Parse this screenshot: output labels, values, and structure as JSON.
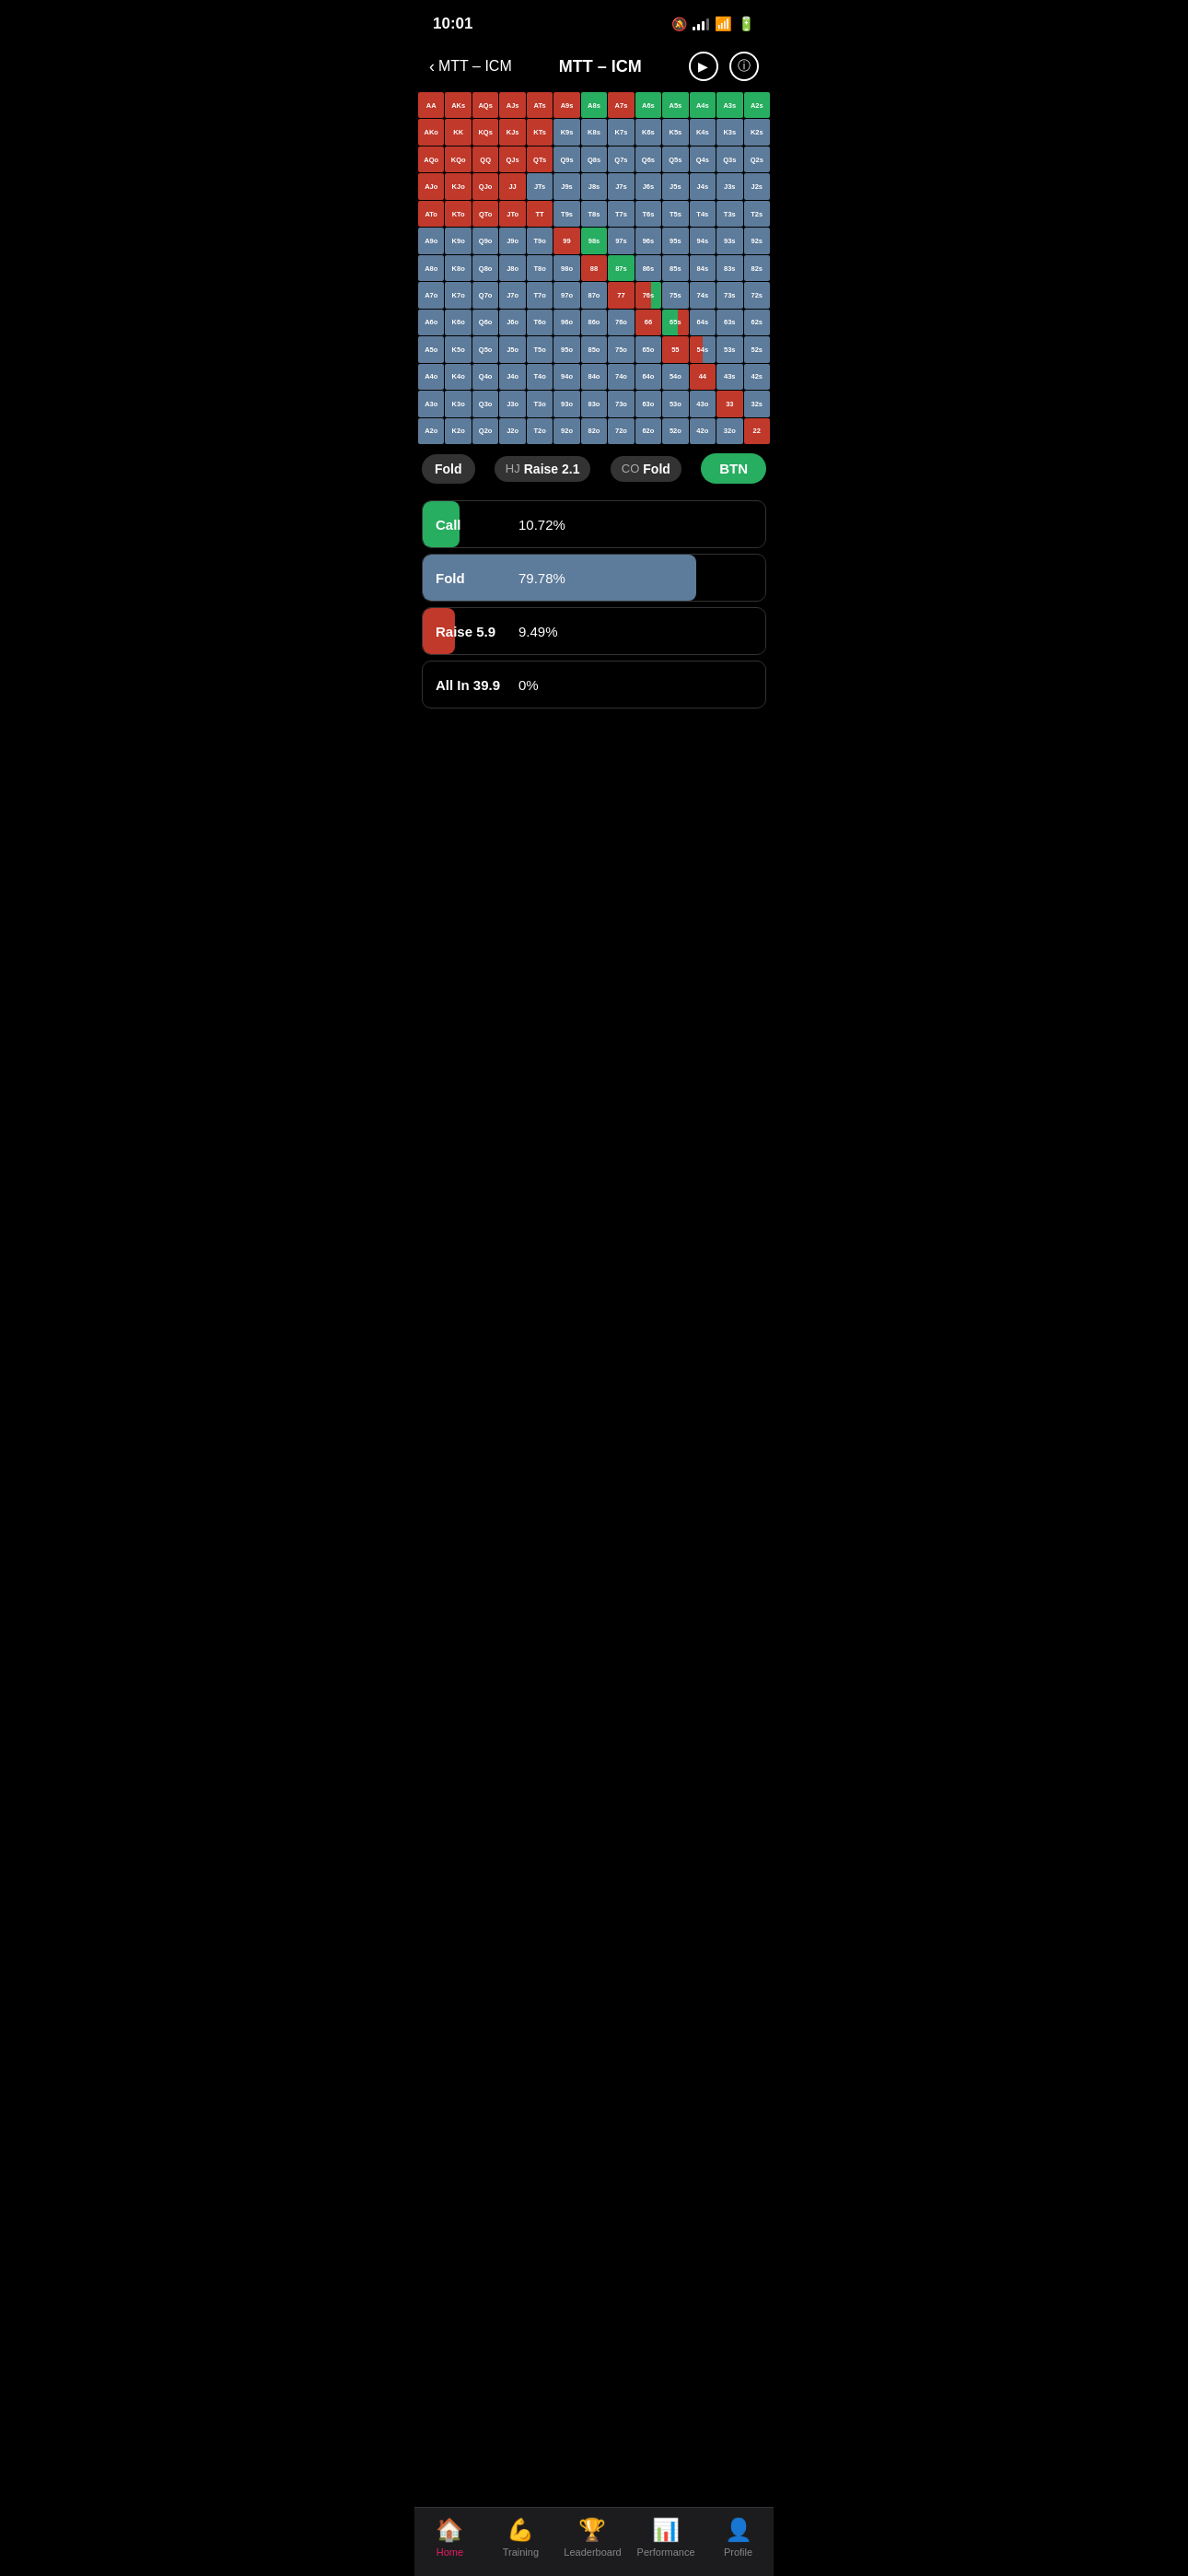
{
  "statusBar": {
    "time": "10:01",
    "bell": "🔕"
  },
  "header": {
    "backLabel": "MTT – ICM",
    "title": "MTT – ICM"
  },
  "grid": {
    "rows": [
      [
        "AA",
        "AKs",
        "AQs",
        "AJs",
        "ATs",
        "A9s",
        "A8s",
        "A7s",
        "A6s",
        "A5s",
        "A4s",
        "A3s",
        "A2s"
      ],
      [
        "AKo",
        "KK",
        "KQs",
        "KJs",
        "KTs",
        "K9s",
        "K8s",
        "K7s",
        "K6s",
        "K5s",
        "K4s",
        "K3s",
        "K2s"
      ],
      [
        "AQo",
        "KQo",
        "QQ",
        "QJs",
        "QTs",
        "Q9s",
        "Q8s",
        "Q7s",
        "Q6s",
        "Q5s",
        "Q4s",
        "Q3s",
        "Q2s"
      ],
      [
        "AJo",
        "KJo",
        "QJo",
        "JJ",
        "JTs",
        "J9s",
        "J8s",
        "J7s",
        "J6s",
        "J5s",
        "J4s",
        "J3s",
        "J2s"
      ],
      [
        "ATo",
        "KTo",
        "QTo",
        "JTo",
        "TT",
        "T9s",
        "T8s",
        "T7s",
        "T6s",
        "T5s",
        "T4s",
        "T3s",
        "T2s"
      ],
      [
        "A9o",
        "K9o",
        "Q9o",
        "J9o",
        "T9o",
        "99",
        "98s",
        "97s",
        "96s",
        "95s",
        "94s",
        "93s",
        "92s"
      ],
      [
        "A8o",
        "K8o",
        "Q8o",
        "J8o",
        "T8o",
        "98o",
        "88",
        "87s",
        "86s",
        "85s",
        "84s",
        "83s",
        "82s"
      ],
      [
        "A7o",
        "K7o",
        "Q7o",
        "J7o",
        "T7o",
        "97o",
        "87o",
        "77",
        "76s",
        "75s",
        "74s",
        "73s",
        "72s"
      ],
      [
        "A6o",
        "K6o",
        "Q6o",
        "J6o",
        "T6o",
        "96o",
        "86o",
        "76o",
        "66",
        "65s",
        "64s",
        "63s",
        "62s"
      ],
      [
        "A5o",
        "K5o",
        "Q5o",
        "J5o",
        "T5o",
        "95o",
        "85o",
        "75o",
        "65o",
        "55",
        "54s",
        "53s",
        "52s"
      ],
      [
        "A4o",
        "K4o",
        "Q4o",
        "J4o",
        "T4o",
        "94o",
        "84o",
        "74o",
        "64o",
        "54o",
        "44",
        "43s",
        "42s"
      ],
      [
        "A3o",
        "K3o",
        "Q3o",
        "J3o",
        "T3o",
        "93o",
        "83o",
        "73o",
        "63o",
        "53o",
        "43o",
        "33",
        "32s"
      ],
      [
        "A2o",
        "K2o",
        "Q2o",
        "J2o",
        "T2o",
        "92o",
        "82o",
        "72o",
        "62o",
        "52o",
        "42o",
        "32o",
        "22"
      ]
    ],
    "colors": [
      [
        "red",
        "red",
        "red",
        "red",
        "red",
        "red",
        "green",
        "red",
        "green",
        "green",
        "green",
        "green",
        "green"
      ],
      [
        "red",
        "red",
        "red",
        "red",
        "red",
        "blue",
        "blue",
        "blue",
        "blue",
        "blue",
        "blue",
        "blue",
        "blue"
      ],
      [
        "red",
        "red",
        "red",
        "red",
        "red",
        "blue",
        "blue",
        "blue",
        "blue",
        "blue",
        "blue",
        "blue",
        "blue"
      ],
      [
        "red",
        "red",
        "red",
        "red",
        "blue",
        "blue",
        "blue",
        "blue",
        "blue",
        "blue",
        "blue",
        "blue",
        "blue"
      ],
      [
        "red",
        "red",
        "red",
        "red",
        "red",
        "blue",
        "blue",
        "blue",
        "blue",
        "blue",
        "blue",
        "blue",
        "blue"
      ],
      [
        "blue",
        "blue",
        "blue",
        "blue",
        "blue",
        "red",
        "green",
        "blue",
        "blue",
        "blue",
        "blue",
        "blue",
        "blue"
      ],
      [
        "blue",
        "blue",
        "blue",
        "blue",
        "blue",
        "blue",
        "red",
        "green",
        "blue",
        "blue",
        "blue",
        "blue",
        "blue"
      ],
      [
        "blue",
        "blue",
        "blue",
        "blue",
        "blue",
        "blue",
        "blue",
        "red",
        "mixed-red-green",
        "blue",
        "blue",
        "blue",
        "blue"
      ],
      [
        "blue",
        "blue",
        "blue",
        "blue",
        "blue",
        "blue",
        "blue",
        "blue",
        "red",
        "mixed-green-red",
        "blue",
        "blue",
        "blue"
      ],
      [
        "blue",
        "blue",
        "blue",
        "blue",
        "blue",
        "blue",
        "blue",
        "blue",
        "blue",
        "red",
        "mixed-red-blue",
        "blue",
        "blue"
      ],
      [
        "blue",
        "blue",
        "blue",
        "blue",
        "blue",
        "blue",
        "blue",
        "blue",
        "blue",
        "blue",
        "red",
        "blue",
        "blue"
      ],
      [
        "blue",
        "blue",
        "blue",
        "blue",
        "blue",
        "blue",
        "blue",
        "blue",
        "blue",
        "blue",
        "blue",
        "red",
        "blue"
      ],
      [
        "blue",
        "blue",
        "blue",
        "blue",
        "blue",
        "blue",
        "blue",
        "blue",
        "blue",
        "blue",
        "blue",
        "blue",
        "red"
      ]
    ]
  },
  "positionBar": {
    "leftLabel": "Fold",
    "hjLabel": "HJ",
    "hjAction": "Raise 2.1",
    "coLabel": "CO",
    "coAction": "Fold",
    "btnLabel": "BTN"
  },
  "actionBars": [
    {
      "name": "Call",
      "pct": "10.72%",
      "fill": 10.72,
      "color": "#27ae60"
    },
    {
      "name": "Fold",
      "pct": "79.78%",
      "fill": 79.78,
      "color": "#5d7b9a"
    },
    {
      "name": "Raise 5.9",
      "pct": "9.49%",
      "fill": 9.49,
      "color": "#c0392b"
    },
    {
      "name": "All In 39.9",
      "pct": "0%",
      "fill": 0,
      "color": "#333"
    }
  ],
  "tabBar": {
    "items": [
      {
        "label": "Home",
        "icon": "🏠",
        "active": true
      },
      {
        "label": "Training",
        "icon": "💪",
        "active": false
      },
      {
        "label": "Leaderboard",
        "icon": "🏆",
        "active": false
      },
      {
        "label": "Performance",
        "icon": "📊",
        "active": false
      },
      {
        "label": "Profile",
        "icon": "👤",
        "active": false
      }
    ]
  }
}
